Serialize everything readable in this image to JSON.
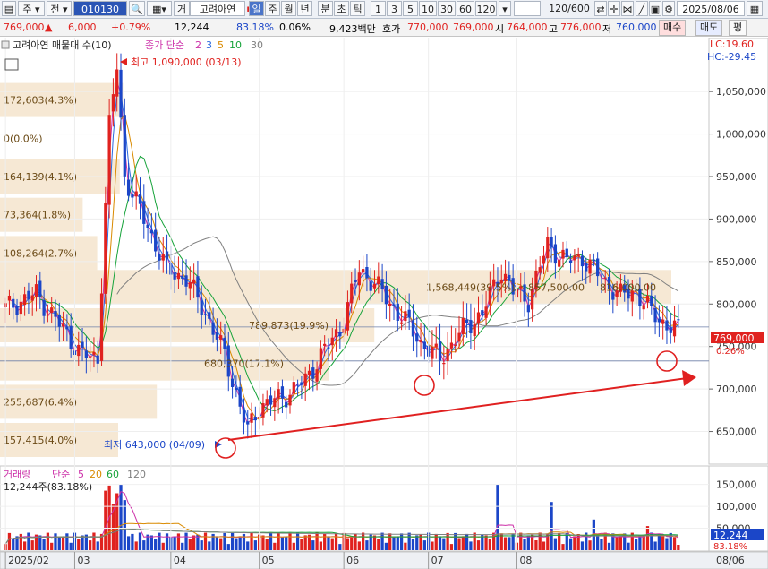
{
  "toolbar": {
    "code": "010130",
    "market_short": "주",
    "scope": "전",
    "type_short": "거",
    "name": "고려아연",
    "periods": [
      "일",
      "주",
      "월",
      "년",
      "분",
      "초",
      "틱"
    ],
    "intervals": [
      "1",
      "3",
      "5",
      "10",
      "30",
      "60",
      "120"
    ],
    "count": "120/600",
    "date": "2025/08/06"
  },
  "quote": {
    "price": "769,000",
    "change": "6,000",
    "change_pct": "+0.79%",
    "volume": "12,244",
    "vol_ratio": "83.18%",
    "turnover_ratio": "0.06%",
    "amount": "9,423백만",
    "bid_label": "호가",
    "ask": "770,000",
    "bid": "769,000",
    "open_label": "시",
    "open": "764,000",
    "high_label": "고",
    "high": "776,000",
    "low_label": "저",
    "low": "760,000",
    "buy_label": "매수",
    "sell_label": "매도",
    "eval_label": "평"
  },
  "legend": {
    "title": "고려아연 매물대 수(10)",
    "ma_label": "종가 단순",
    "ma": [
      "2",
      "3",
      "5",
      "10",
      "30"
    ],
    "ma_colors": [
      "#cc2fa8",
      "#2b6adf",
      "#d98a00",
      "#16a33a",
      "#808080"
    ],
    "lc": "LC:19.60",
    "hc": "HC:-29.45"
  },
  "annotations": {
    "high": "최고 1,090,000 (03/13)",
    "low": "최저 643,000 (04/09)"
  },
  "price_axis": [
    "1,050,000",
    "1,000,000",
    "950,000",
    "900,000",
    "850,000",
    "800,000",
    "750,000",
    "700,000",
    "650,000"
  ],
  "price_tag": {
    "value": "769,000",
    "pct": "0.26%"
  },
  "volume_legend": {
    "title": "거래량",
    "ma_label": "단순",
    "ma": [
      "5",
      "20",
      "60",
      "120"
    ],
    "ma_colors": [
      "#cc2fa8",
      "#d98a00",
      "#16a33a",
      "#808080"
    ],
    "current": "12,244주(83.18%)"
  },
  "volume_axis": [
    "150,000",
    "100,000",
    "50,000"
  ],
  "volume_tag": {
    "value": "12,244",
    "pct": "83.18%"
  },
  "x_axis": [
    "2025/02",
    "03",
    "04",
    "05",
    "06",
    "07",
    "08",
    "08/06"
  ],
  "chart_data": {
    "type": "candlestick",
    "price_ylim": [
      620000,
      1105000
    ],
    "volume_ylim": [
      0,
      180000
    ],
    "volume_profile": [
      {
        "price": 1040000,
        "label": "172,603(4.3%)",
        "share": 4.3
      },
      {
        "price": 995000,
        "label": "0(0.0%)",
        "share": 0.0
      },
      {
        "price": 950000,
        "label": "164,139(4.1%)",
        "share": 4.1
      },
      {
        "price": 905000,
        "label": "73,364(1.8%)",
        "share": 1.8
      },
      {
        "price": 860000,
        "label": "108,264(2.7%)",
        "share": 2.7
      },
      {
        "price": 820000,
        "label": "1,568,449(39.5%)",
        "share": 39.5
      },
      {
        "price": 820000,
        "label": "857,500.00",
        "share": 0
      },
      {
        "price": 820000,
        "label": "816,000.00",
        "share": 0
      },
      {
        "price": 775000,
        "label": "789,873(19.9%)",
        "share": 19.9
      },
      {
        "price": 730000,
        "label": "680,370(17.1%)",
        "share": 17.1
      },
      {
        "price": 685000,
        "label": "255,687(6.4%)",
        "share": 6.4
      },
      {
        "price": 640000,
        "label": "157,415(4.0%)",
        "share": 4.0
      }
    ]
  }
}
